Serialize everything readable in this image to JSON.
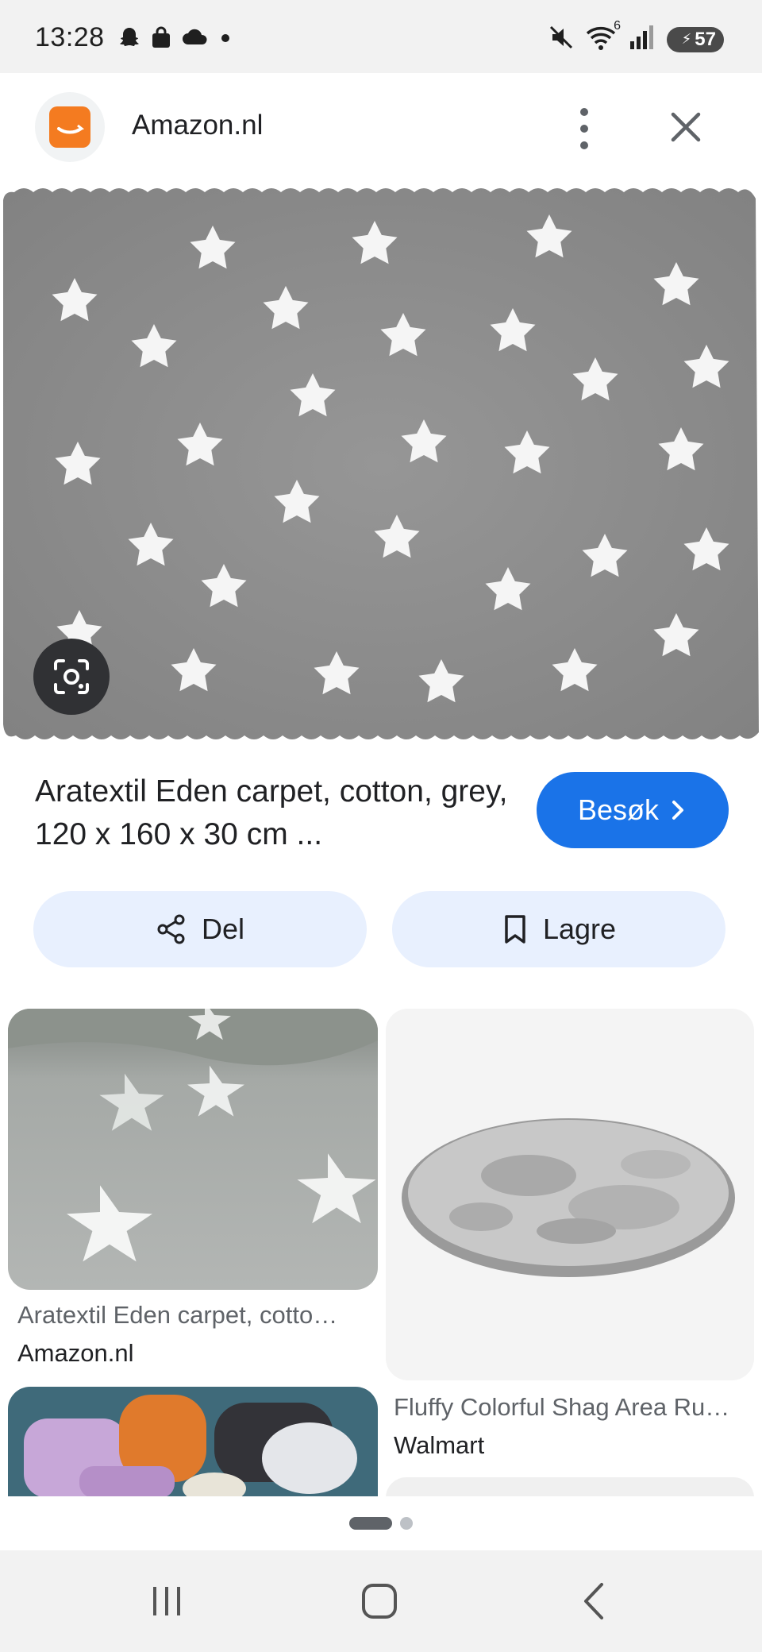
{
  "status_bar": {
    "time": "13:28",
    "left_icons": [
      "snapchat-icon",
      "shopping-bag-icon",
      "cloud-icon",
      "dot-icon"
    ],
    "right_icons": [
      "mute-icon",
      "wifi-icon",
      "signal-icon"
    ],
    "wifi_label": "6",
    "battery": "57"
  },
  "header": {
    "site_name": "Amazon.nl",
    "logo_color": "#f47b20"
  },
  "result": {
    "title": "Aratextil Eden carpet, cotton, grey, 120 x 160 x 30 cm ...",
    "visit_label": "Besøk",
    "share_label": "Del",
    "save_label": "Lagre"
  },
  "related": [
    {
      "title": "Aratextil Eden carpet, cotto…",
      "source": "Amazon.nl"
    },
    {
      "title": "Fluffy Colorful Shag Area Ru…",
      "source": "Walmart"
    }
  ],
  "colors": {
    "accent": "#1a73e8",
    "chip_bg": "#e8f0fe",
    "rug_grey": "#8f8f8f"
  },
  "nav": [
    "recent-apps-icon",
    "home-icon",
    "back-icon"
  ]
}
